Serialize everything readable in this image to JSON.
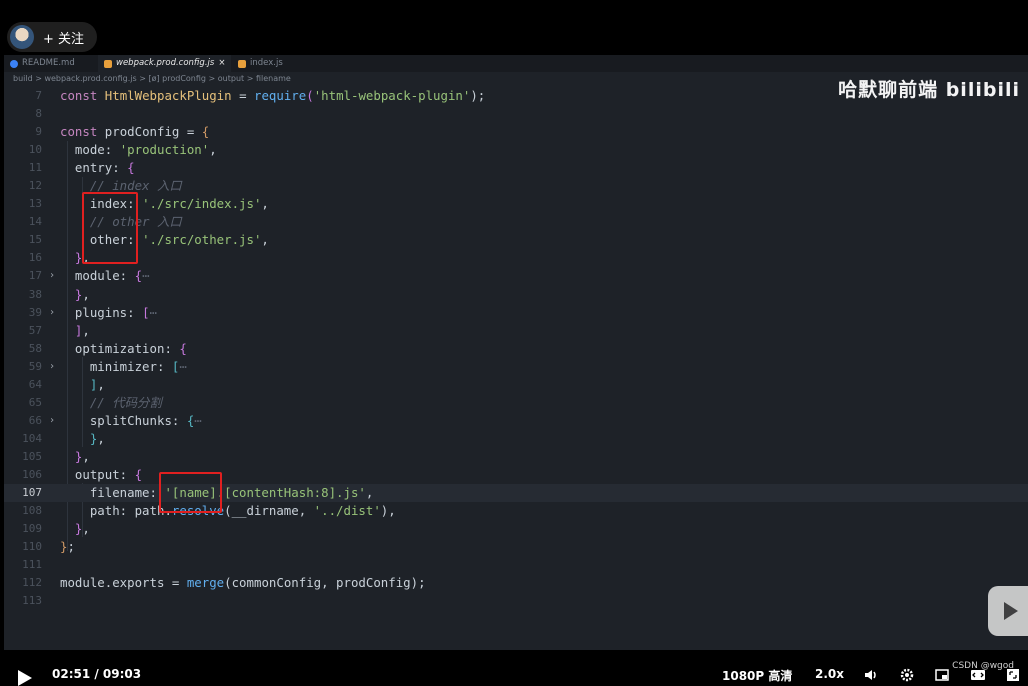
{
  "follow": {
    "label": "+ 关注"
  },
  "tabs": [
    {
      "label": "README.md"
    },
    {
      "label": "webpack.prod.config.js",
      "close": "×"
    },
    {
      "label": "index.js"
    }
  ],
  "breadcrumb": {
    "text": "build > webpack.prod.config.js > [ø] prodConfig > output > filename"
  },
  "watermark": {
    "text": "哈默聊前端 bilibili"
  },
  "code_lines": [
    {
      "n": "7"
    },
    {
      "n": "8"
    },
    {
      "n": "9"
    },
    {
      "n": "10"
    },
    {
      "n": "11"
    },
    {
      "n": "12"
    },
    {
      "n": "13"
    },
    {
      "n": "14"
    },
    {
      "n": "15"
    },
    {
      "n": "16"
    },
    {
      "n": "17"
    },
    {
      "n": "38"
    },
    {
      "n": "39"
    },
    {
      "n": "57"
    },
    {
      "n": "58"
    },
    {
      "n": "59"
    },
    {
      "n": "64"
    },
    {
      "n": "65"
    },
    {
      "n": "66"
    },
    {
      "n": "104"
    },
    {
      "n": "105"
    },
    {
      "n": "106"
    },
    {
      "n": "107"
    },
    {
      "n": "108"
    },
    {
      "n": "109"
    },
    {
      "n": "110"
    },
    {
      "n": "111"
    },
    {
      "n": "112"
    },
    {
      "n": "113"
    }
  ],
  "code": {
    "l7_kw": "const",
    "l7_cls": "HtmlWebpackPlugin",
    "l7_eq": " = ",
    "l7_fn": "require",
    "l7_str": "'html-webpack-plugin'",
    "l7_end": ");",
    "l9_kw": "const",
    "l9_name": " prodConfig = ",
    "l9_br": "{",
    "l10_prop": "mode: ",
    "l10_str": "'production'",
    "l10_end": ",",
    "l11_prop": "entry: ",
    "l11_br": "{",
    "l12_com": "// index 入口",
    "l13_prop": "index: ",
    "l13_str": "'./src/index.js'",
    "l13_end": ",",
    "l14_com": "// other 入口",
    "l15_prop": "other: ",
    "l15_str": "'./src/other.js'",
    "l15_end": ",",
    "l16_br": "}",
    "l16_end": ",",
    "l17_prop": "module: ",
    "l17_br": "{",
    "l17_dots": "⋯",
    "l38_br": "}",
    "l38_end": ",",
    "l39_prop": "plugins: ",
    "l39_br": "[",
    "l39_dots": "⋯",
    "l57_br": "]",
    "l57_end": ",",
    "l58_prop": "optimization: ",
    "l58_br": "{",
    "l59_prop": "minimizer: ",
    "l59_br": "[",
    "l59_dots": "⋯",
    "l64_br": "]",
    "l64_end": ",",
    "l65_com": "// 代码分割",
    "l66_prop": "splitChunks: ",
    "l66_br": "{",
    "l66_dots": "⋯",
    "l104_br": "}",
    "l104_end": ",",
    "l105_br": "}",
    "l105_end": ",",
    "l106_prop": "output: ",
    "l106_br": "{",
    "l107_prop": "filename: ",
    "l107_str": "'[name].[contentHash:8].js'",
    "l107_end": ",",
    "l108_prop": "path: path.",
    "l108_fn": "resolve",
    "l108_args1": "(__dirname, ",
    "l108_str": "'../dist'",
    "l108_end": "),",
    "l109_br": "}",
    "l109_end": ",",
    "l110_br": "}",
    "l110_end": ";",
    "l112_a": "module.exports = ",
    "l112_fn": "merge",
    "l112_b": "(commonConfig, prodConfig);"
  },
  "player": {
    "time": "02:51 / 09:03",
    "quality": "1080P 高清",
    "speed": "2.0x",
    "progress_fraction": 0.315,
    "credit": "CSDN @wgod"
  }
}
